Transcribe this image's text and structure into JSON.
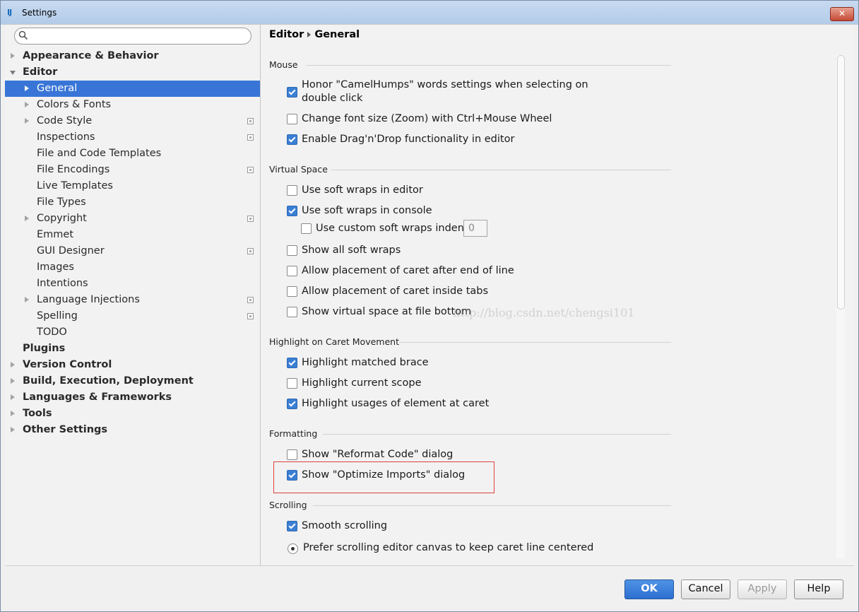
{
  "window": {
    "title": "Settings",
    "close_label": "✕"
  },
  "sidebar": {
    "search_value": "",
    "items": [
      {
        "label": "Appearance & Behavior",
        "level": 0
      },
      {
        "label": "Editor",
        "level": 0
      },
      {
        "label": "General",
        "level": 1
      },
      {
        "label": "Colors & Fonts",
        "level": 1
      },
      {
        "label": "Code Style",
        "level": 1
      },
      {
        "label": "Inspections",
        "level": 1
      },
      {
        "label": "File and Code Templates",
        "level": 1
      },
      {
        "label": "File Encodings",
        "level": 1
      },
      {
        "label": "Live Templates",
        "level": 1
      },
      {
        "label": "File Types",
        "level": 1
      },
      {
        "label": "Copyright",
        "level": 1
      },
      {
        "label": "Emmet",
        "level": 1
      },
      {
        "label": "GUI Designer",
        "level": 1
      },
      {
        "label": "Images",
        "level": 1
      },
      {
        "label": "Intentions",
        "level": 1
      },
      {
        "label": "Language Injections",
        "level": 1
      },
      {
        "label": "Spelling",
        "level": 1
      },
      {
        "label": "TODO",
        "level": 1
      },
      {
        "label": "Plugins",
        "level": 0
      },
      {
        "label": "Version Control",
        "level": 0
      },
      {
        "label": "Build, Execution, Deployment",
        "level": 0
      },
      {
        "label": "Languages & Frameworks",
        "level": 0
      },
      {
        "label": "Tools",
        "level": 0
      },
      {
        "label": "Other Settings",
        "level": 0
      }
    ]
  },
  "breadcrumb": {
    "parent": "Editor",
    "current": "General"
  },
  "sections": {
    "mouse": {
      "title": "Mouse",
      "opts": [
        {
          "label_line1": "Honor \"CamelHumps\" words settings when selecting on",
          "label_line2": "double click",
          "checked": true
        },
        {
          "label": "Change font size (Zoom) with Ctrl+Mouse Wheel",
          "checked": false
        },
        {
          "label": "Enable Drag'n'Drop functionality in editor",
          "checked": true
        }
      ]
    },
    "virtual_space": {
      "title": "Virtual Space",
      "opts": [
        {
          "label": "Use soft wraps in editor",
          "checked": false
        },
        {
          "label": "Use soft wraps in console",
          "checked": true
        },
        {
          "label": "Use custom soft wraps indent",
          "checked": false,
          "value": "0"
        },
        {
          "label": "Show all soft wraps",
          "checked": false
        },
        {
          "label": "Allow placement of caret after end of line",
          "checked": false
        },
        {
          "label": "Allow placement of caret inside tabs",
          "checked": false
        },
        {
          "label": "Show virtual space at file bottom",
          "checked": false
        }
      ]
    },
    "highlight": {
      "title": "Highlight on Caret Movement",
      "opts": [
        {
          "label": "Highlight matched brace",
          "checked": true
        },
        {
          "label": "Highlight current scope",
          "checked": false
        },
        {
          "label": "Highlight usages of element at caret",
          "checked": true
        }
      ]
    },
    "formatting": {
      "title": "Formatting",
      "opts": [
        {
          "label": "Show \"Reformat Code\" dialog",
          "checked": false
        },
        {
          "label": "Show \"Optimize Imports\" dialog",
          "checked": true
        }
      ]
    },
    "scrolling": {
      "title": "Scrolling",
      "opts": [
        {
          "label": "Smooth scrolling",
          "checked": true
        },
        {
          "label": "Prefer scrolling editor canvas to keep caret line centered",
          "selected": true
        }
      ]
    }
  },
  "watermark": "http://blog.csdn.net/chengsi101",
  "footer": {
    "ok": "OK",
    "cancel": "Cancel",
    "apply": "Apply",
    "help": "Help"
  }
}
